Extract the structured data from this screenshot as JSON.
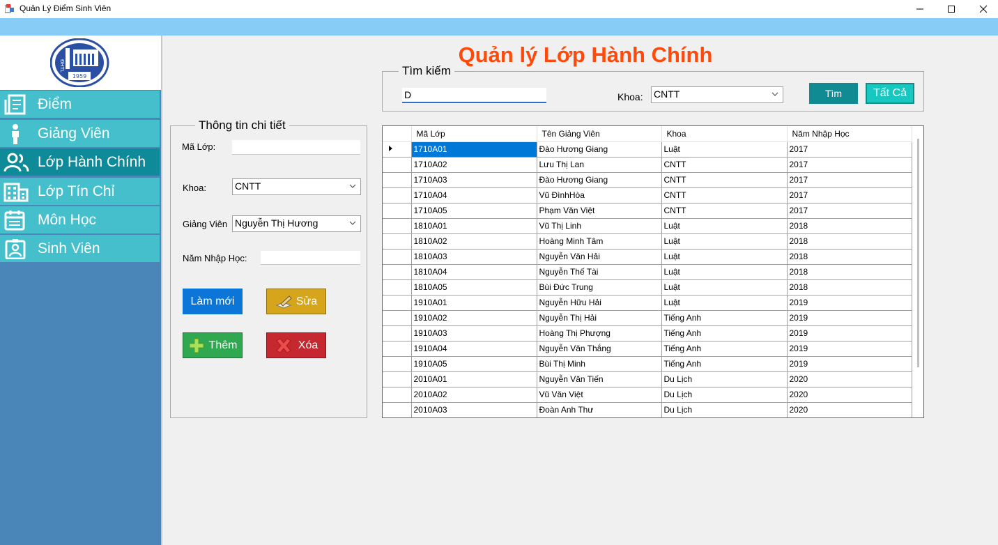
{
  "window": {
    "title": "Quản Lý Điểm Sinh Viên",
    "controls": [
      "minimize-icon",
      "maximize-icon",
      "close-icon"
    ]
  },
  "logo": {
    "text_left": "ĐHTL",
    "year": "1959"
  },
  "sidebar": {
    "items": [
      {
        "label": "Điểm",
        "icon": "document-icon"
      },
      {
        "label": "Giảng Viên",
        "icon": "person-icon"
      },
      {
        "label": "Lớp Hành Chính",
        "icon": "group-icon",
        "active": true
      },
      {
        "label": "Lớp Tín Chỉ",
        "icon": "building-icon"
      },
      {
        "label": "Môn Học",
        "icon": "calendar-icon"
      },
      {
        "label": "Sinh Viên",
        "icon": "id-card-icon"
      }
    ]
  },
  "page_title": "Quản lý Lớp Hành Chính",
  "search": {
    "legend": "Tìm kiếm",
    "value": "D",
    "khoa_label": "Khoa:",
    "khoa_value": "CNTT",
    "search_button": "Tìm",
    "all_button": "Tất Cả"
  },
  "details": {
    "legend": "Thông tin chi tiết",
    "ma_lop_label": "Mã Lớp:",
    "ma_lop_value": "",
    "khoa_label": "Khoa:",
    "khoa_value": "CNTT",
    "giang_vien_label": "Giảng Viên",
    "giang_vien_value": "Nguyễn Thị Hương",
    "nam_label": "Năm Nhập Học:",
    "nam_value": "",
    "buttons": {
      "refresh": "Làm mới",
      "edit": "Sửa",
      "add": "Thêm",
      "delete": "Xóa"
    }
  },
  "colors": {
    "title": "#ff4a0b",
    "sidebar_item": "#45bfcb",
    "sidebar_active": "#0f8a99",
    "sidebar_bg": "#4a86b8",
    "btn_refresh": "#0b76d8",
    "btn_edit": "#d6a51b",
    "btn_add": "#2fa84f",
    "btn_delete": "#c5282f",
    "btn_search": "#108a93",
    "btn_all": "#17c8c0"
  },
  "grid": {
    "columns": [
      "Mã Lớp",
      "Tên Giảng Viên",
      "Khoa",
      "Năm Nhập Học"
    ],
    "rows": [
      [
        "1710A01",
        "Đào Hương Giang",
        "Luật",
        "2017"
      ],
      [
        "1710A02",
        "Lưu Thị Lan",
        "CNTT",
        "2017"
      ],
      [
        "1710A03",
        "Đào Hương Giang",
        "CNTT",
        "2017"
      ],
      [
        "1710A04",
        "Vũ ĐìnhHòa",
        "CNTT",
        "2017"
      ],
      [
        "1710A05",
        "Phạm Văn Việt",
        "CNTT",
        "2017"
      ],
      [
        "1810A01",
        "Vũ Thị Linh",
        "Luật",
        "2018"
      ],
      [
        "1810A02",
        "Hoàng Minh Tâm",
        "Luật",
        "2018"
      ],
      [
        "1810A03",
        "Nguyễn Văn Hải",
        "Luật",
        "2018"
      ],
      [
        "1810A04",
        "Nguyễn Thế Tài",
        "Luật",
        "2018"
      ],
      [
        "1810A05",
        "Bùi Đức Trung",
        "Luật",
        "2018"
      ],
      [
        "1910A01",
        "Nguyễn Hữu Hải",
        "Luật",
        "2019"
      ],
      [
        "1910A02",
        "Nguyễn Thị Hải",
        "Tiếng Anh",
        "2019"
      ],
      [
        "1910A03",
        "Hoàng Thị Phượng",
        "Tiếng Anh",
        "2019"
      ],
      [
        "1910A04",
        "Nguyễn Văn Thắng",
        "Tiếng Anh",
        "2019"
      ],
      [
        "1910A05",
        "Bùi Thị Minh",
        "Tiếng Anh",
        "2019"
      ],
      [
        "2010A01",
        "Nguyễn Văn Tiến",
        "Du Lịch",
        "2020"
      ],
      [
        "2010A02",
        "Vũ Văn Việt",
        "Du Lịch",
        "2020"
      ],
      [
        "2010A03",
        "Đoàn Anh Thư",
        "Du Lịch",
        "2020"
      ]
    ]
  }
}
